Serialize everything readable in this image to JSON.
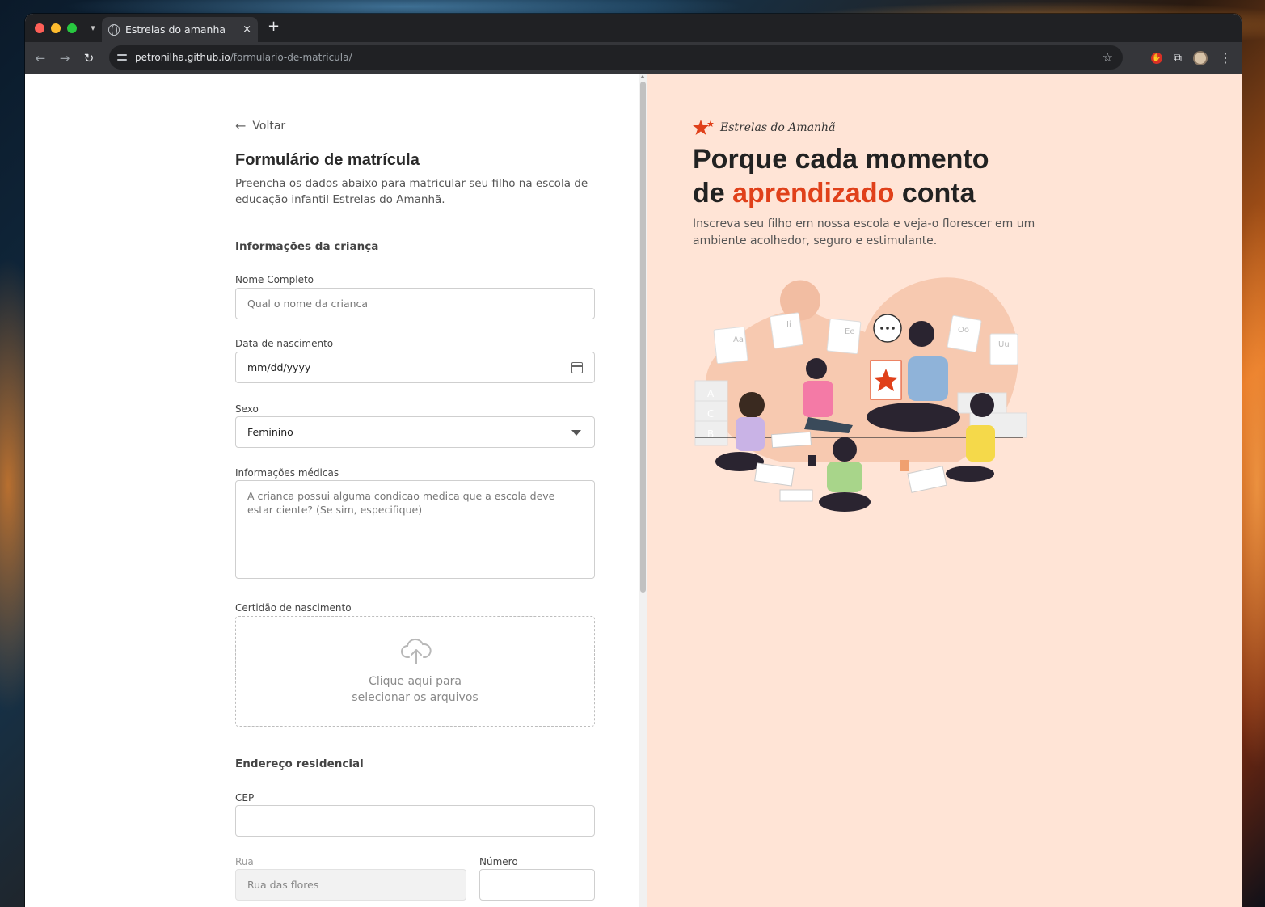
{
  "browser": {
    "tab_title": "Estrelas do amanha",
    "new_tab": "+",
    "tab_close": "×",
    "url_host": "petronilha.github.io",
    "url_path": "/formulario-de-matricula/"
  },
  "form": {
    "back_label": "Voltar",
    "title": "Formulário de matrícula",
    "description": "Preencha os dados abaixo para matricular seu filho na escola de educação infantil Estrelas do Amanhã.",
    "section_child": "Informações da criança",
    "name_label": "Nome Completo",
    "name_placeholder": "Qual o nome da crianca",
    "birth_label": "Data de nascimento",
    "birth_value": "mm/dd/yyyy",
    "sex_label": "Sexo",
    "sex_value": "Feminino",
    "medical_label": "Informações médicas",
    "medical_placeholder": "A crianca possui alguma condicao medica que a escola deve estar ciente? (Se sim, especifique)",
    "certificate_label": "Certidão de nascimento",
    "upload_text_1": "Clique aqui para",
    "upload_text_2": "selecionar os arquivos",
    "section_address": "Endereço residencial",
    "cep_label": "CEP",
    "street_label": "Rua",
    "street_placeholder": "Rua das flores",
    "number_label": "Número"
  },
  "hero": {
    "brand": "Estrelas do Amanhã",
    "headline_1": "Porque cada momento",
    "headline_2_pre": "de ",
    "headline_2_accent": "aprendizado",
    "headline_2_post": " conta",
    "subtitle": "Inscreva seu filho em nossa escola e veja-o florescer em um ambiente acolhedor, seguro e estimulante.",
    "accent_color": "#e0401a",
    "background_color": "#ffe4d6",
    "illustration_labels": [
      "Aa",
      "Ii",
      "Ee",
      "Oo",
      "Uu",
      "A",
      "C",
      "B"
    ]
  }
}
